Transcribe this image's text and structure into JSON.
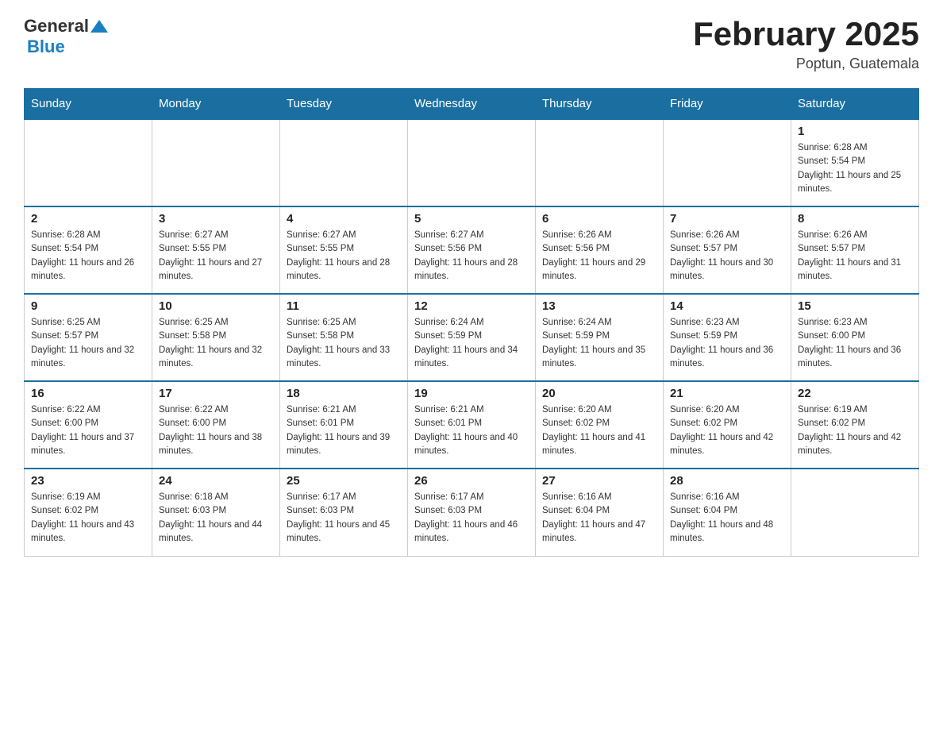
{
  "header": {
    "logo_general": "General",
    "logo_blue": "Blue",
    "title": "February 2025",
    "subtitle": "Poptun, Guatemala"
  },
  "days_of_week": [
    "Sunday",
    "Monday",
    "Tuesday",
    "Wednesday",
    "Thursday",
    "Friday",
    "Saturday"
  ],
  "weeks": [
    [
      {
        "day": "",
        "sunrise": "",
        "sunset": "",
        "daylight": ""
      },
      {
        "day": "",
        "sunrise": "",
        "sunset": "",
        "daylight": ""
      },
      {
        "day": "",
        "sunrise": "",
        "sunset": "",
        "daylight": ""
      },
      {
        "day": "",
        "sunrise": "",
        "sunset": "",
        "daylight": ""
      },
      {
        "day": "",
        "sunrise": "",
        "sunset": "",
        "daylight": ""
      },
      {
        "day": "",
        "sunrise": "",
        "sunset": "",
        "daylight": ""
      },
      {
        "day": "1",
        "sunrise": "Sunrise: 6:28 AM",
        "sunset": "Sunset: 5:54 PM",
        "daylight": "Daylight: 11 hours and 25 minutes."
      }
    ],
    [
      {
        "day": "2",
        "sunrise": "Sunrise: 6:28 AM",
        "sunset": "Sunset: 5:54 PM",
        "daylight": "Daylight: 11 hours and 26 minutes."
      },
      {
        "day": "3",
        "sunrise": "Sunrise: 6:27 AM",
        "sunset": "Sunset: 5:55 PM",
        "daylight": "Daylight: 11 hours and 27 minutes."
      },
      {
        "day": "4",
        "sunrise": "Sunrise: 6:27 AM",
        "sunset": "Sunset: 5:55 PM",
        "daylight": "Daylight: 11 hours and 28 minutes."
      },
      {
        "day": "5",
        "sunrise": "Sunrise: 6:27 AM",
        "sunset": "Sunset: 5:56 PM",
        "daylight": "Daylight: 11 hours and 28 minutes."
      },
      {
        "day": "6",
        "sunrise": "Sunrise: 6:26 AM",
        "sunset": "Sunset: 5:56 PM",
        "daylight": "Daylight: 11 hours and 29 minutes."
      },
      {
        "day": "7",
        "sunrise": "Sunrise: 6:26 AM",
        "sunset": "Sunset: 5:57 PM",
        "daylight": "Daylight: 11 hours and 30 minutes."
      },
      {
        "day": "8",
        "sunrise": "Sunrise: 6:26 AM",
        "sunset": "Sunset: 5:57 PM",
        "daylight": "Daylight: 11 hours and 31 minutes."
      }
    ],
    [
      {
        "day": "9",
        "sunrise": "Sunrise: 6:25 AM",
        "sunset": "Sunset: 5:57 PM",
        "daylight": "Daylight: 11 hours and 32 minutes."
      },
      {
        "day": "10",
        "sunrise": "Sunrise: 6:25 AM",
        "sunset": "Sunset: 5:58 PM",
        "daylight": "Daylight: 11 hours and 32 minutes."
      },
      {
        "day": "11",
        "sunrise": "Sunrise: 6:25 AM",
        "sunset": "Sunset: 5:58 PM",
        "daylight": "Daylight: 11 hours and 33 minutes."
      },
      {
        "day": "12",
        "sunrise": "Sunrise: 6:24 AM",
        "sunset": "Sunset: 5:59 PM",
        "daylight": "Daylight: 11 hours and 34 minutes."
      },
      {
        "day": "13",
        "sunrise": "Sunrise: 6:24 AM",
        "sunset": "Sunset: 5:59 PM",
        "daylight": "Daylight: 11 hours and 35 minutes."
      },
      {
        "day": "14",
        "sunrise": "Sunrise: 6:23 AM",
        "sunset": "Sunset: 5:59 PM",
        "daylight": "Daylight: 11 hours and 36 minutes."
      },
      {
        "day": "15",
        "sunrise": "Sunrise: 6:23 AM",
        "sunset": "Sunset: 6:00 PM",
        "daylight": "Daylight: 11 hours and 36 minutes."
      }
    ],
    [
      {
        "day": "16",
        "sunrise": "Sunrise: 6:22 AM",
        "sunset": "Sunset: 6:00 PM",
        "daylight": "Daylight: 11 hours and 37 minutes."
      },
      {
        "day": "17",
        "sunrise": "Sunrise: 6:22 AM",
        "sunset": "Sunset: 6:00 PM",
        "daylight": "Daylight: 11 hours and 38 minutes."
      },
      {
        "day": "18",
        "sunrise": "Sunrise: 6:21 AM",
        "sunset": "Sunset: 6:01 PM",
        "daylight": "Daylight: 11 hours and 39 minutes."
      },
      {
        "day": "19",
        "sunrise": "Sunrise: 6:21 AM",
        "sunset": "Sunset: 6:01 PM",
        "daylight": "Daylight: 11 hours and 40 minutes."
      },
      {
        "day": "20",
        "sunrise": "Sunrise: 6:20 AM",
        "sunset": "Sunset: 6:02 PM",
        "daylight": "Daylight: 11 hours and 41 minutes."
      },
      {
        "day": "21",
        "sunrise": "Sunrise: 6:20 AM",
        "sunset": "Sunset: 6:02 PM",
        "daylight": "Daylight: 11 hours and 42 minutes."
      },
      {
        "day": "22",
        "sunrise": "Sunrise: 6:19 AM",
        "sunset": "Sunset: 6:02 PM",
        "daylight": "Daylight: 11 hours and 42 minutes."
      }
    ],
    [
      {
        "day": "23",
        "sunrise": "Sunrise: 6:19 AM",
        "sunset": "Sunset: 6:02 PM",
        "daylight": "Daylight: 11 hours and 43 minutes."
      },
      {
        "day": "24",
        "sunrise": "Sunrise: 6:18 AM",
        "sunset": "Sunset: 6:03 PM",
        "daylight": "Daylight: 11 hours and 44 minutes."
      },
      {
        "day": "25",
        "sunrise": "Sunrise: 6:17 AM",
        "sunset": "Sunset: 6:03 PM",
        "daylight": "Daylight: 11 hours and 45 minutes."
      },
      {
        "day": "26",
        "sunrise": "Sunrise: 6:17 AM",
        "sunset": "Sunset: 6:03 PM",
        "daylight": "Daylight: 11 hours and 46 minutes."
      },
      {
        "day": "27",
        "sunrise": "Sunrise: 6:16 AM",
        "sunset": "Sunset: 6:04 PM",
        "daylight": "Daylight: 11 hours and 47 minutes."
      },
      {
        "day": "28",
        "sunrise": "Sunrise: 6:16 AM",
        "sunset": "Sunset: 6:04 PM",
        "daylight": "Daylight: 11 hours and 48 minutes."
      },
      {
        "day": "",
        "sunrise": "",
        "sunset": "",
        "daylight": ""
      }
    ]
  ]
}
